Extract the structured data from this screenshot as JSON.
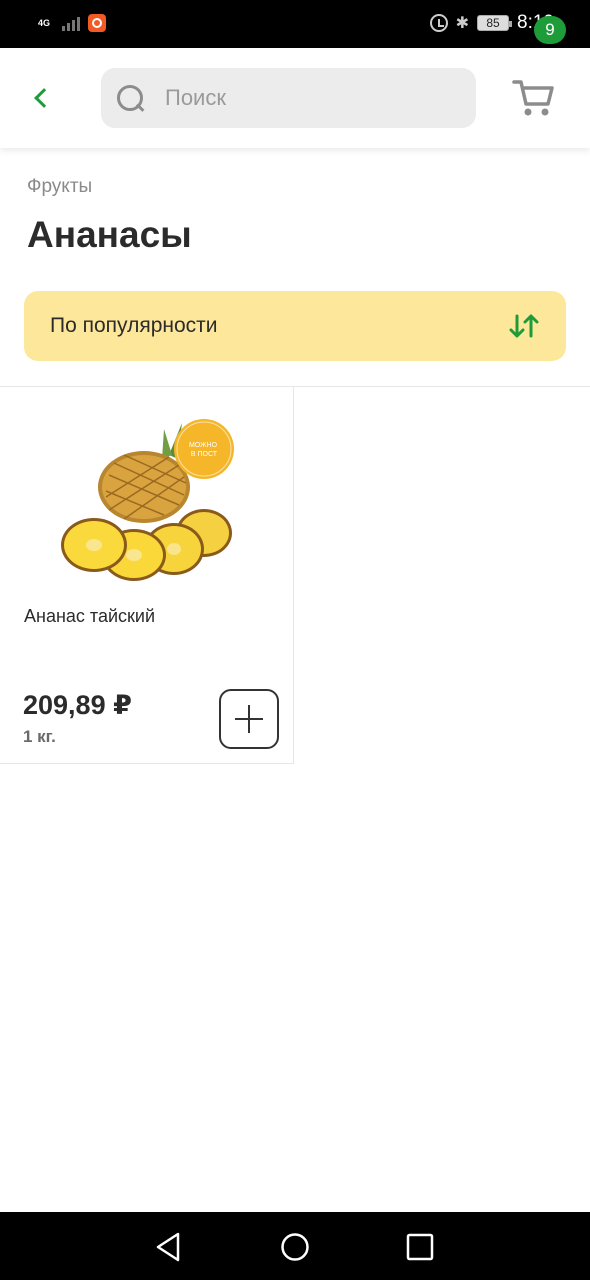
{
  "status_bar": {
    "network": "4G",
    "battery": "85",
    "time": "8:19"
  },
  "header": {
    "search_placeholder": "Поиск",
    "cart_count": "9"
  },
  "breadcrumb": "Фрукты",
  "page_title": "Ананасы",
  "sort": {
    "label": "По популярности"
  },
  "products": [
    {
      "name": "Ананас тайский",
      "price": "209,89 ₽",
      "unit": "1 кг.",
      "badge_text": "МОЖНО В ПОСТ"
    }
  ],
  "colors": {
    "accent_green": "#1e9c3a",
    "sort_bg": "#fde79b"
  }
}
